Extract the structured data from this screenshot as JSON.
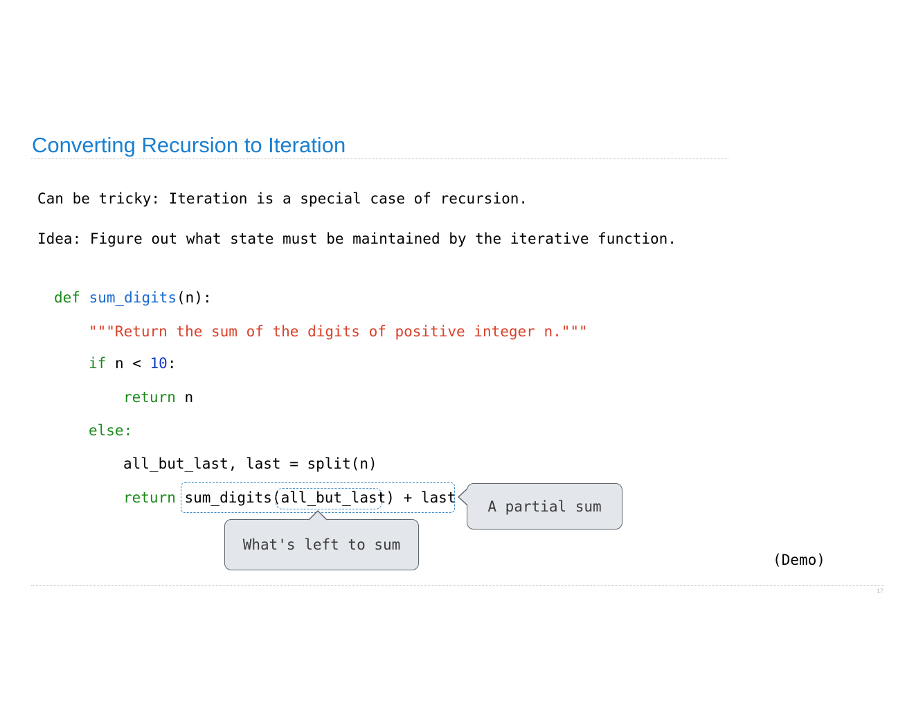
{
  "slide": {
    "title": "Converting Recursion to Iteration",
    "line1": "Can be tricky: Iteration is a special case of recursion.",
    "line2": "Idea: Figure out what state must be maintained by the iterative function.",
    "page_number": "17",
    "demo": "(Demo)"
  },
  "code": {
    "def_kw": "def",
    "fn_name": "sum_digits",
    "def_rest": "(n):",
    "docstring": "\"\"\"Return the sum of the digits of positive integer n.\"\"\"",
    "if_kw": "if",
    "if_mid": " n < ",
    "if_num": "10",
    "if_colon": ":",
    "return_kw": "return",
    "return_n": " n",
    "else_kw": "else:",
    "split_line": "all_but_last, last = split(n)",
    "return2_kw": "return",
    "return2_expr": " sum_digits(all_but_last) + last"
  },
  "callouts": {
    "partial_sum": "A partial sum",
    "left_to_sum": "What's left to sum"
  },
  "colors": {
    "title": "#1a7fd0",
    "keyword": "#1a8a1a",
    "function": "#1a6ad0",
    "string": "#d8412a",
    "number": "#1537c8",
    "dashed_outline": "#3a8ac5",
    "callout_fill": "#e3e7eb"
  }
}
